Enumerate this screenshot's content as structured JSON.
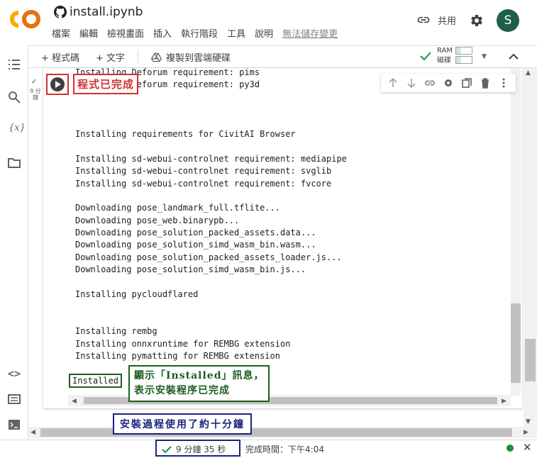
{
  "header": {
    "title": "install.ipynb",
    "share_label": "共用",
    "avatar_letter": "S",
    "menu": [
      "檔案",
      "編輯",
      "檢視畫面",
      "插入",
      "執行階段",
      "工具",
      "說明"
    ],
    "unsaved_label": "無法儲存變更"
  },
  "toolbar": {
    "add_code": "+ 程式碼",
    "add_text": "+ 文字",
    "copy_drive": "複製到雲端硬碟",
    "ram_label": "RAM",
    "disk_label": "磁碟"
  },
  "cell": {
    "gutter_time": "9 分鐘",
    "output_lines": [
      "Installing Deforum requirement: pims",
      "Installing Deforum requirement: py3d",
      "",
      "",
      "",
      "Installing requirements for CivitAI Browser",
      "",
      "Installing sd-webui-controlnet requirement: mediapipe",
      "Installing sd-webui-controlnet requirement: svglib",
      "Installing sd-webui-controlnet requirement: fvcore",
      "",
      "Downloading pose_landmark_full.tflite...",
      "Downloading pose_web.binarypb...",
      "Downloading pose_solution_packed_assets.data...",
      "Downloading pose_solution_simd_wasm_bin.wasm...",
      "Downloading pose_solution_packed_assets_loader.js...",
      "Downloading pose_solution_simd_wasm_bin.js...",
      "",
      "Installing pycloudflared",
      "",
      "",
      "Installing rembg",
      "Installing onnxruntime for REMBG extension",
      "Installing pymatting for REMBG extension"
    ],
    "installed": "Installed"
  },
  "annotations": {
    "run_done": "程式已完成",
    "installed_note_1": "顯示「Installed」訊息，",
    "installed_note_2": "表示安裝程序已完成",
    "duration_note": "安裝過程使用了約十分鐘"
  },
  "status": {
    "elapsed": "9 分鐘 35 秒",
    "finished": "完成時間：下午4:04"
  },
  "colors": {
    "accent_red": "#d32f2f",
    "accent_green": "#1b5e20",
    "accent_blue": "#1a237e",
    "avatar_bg": "#1e5e4b",
    "colab_orange": "#f9ab00"
  }
}
